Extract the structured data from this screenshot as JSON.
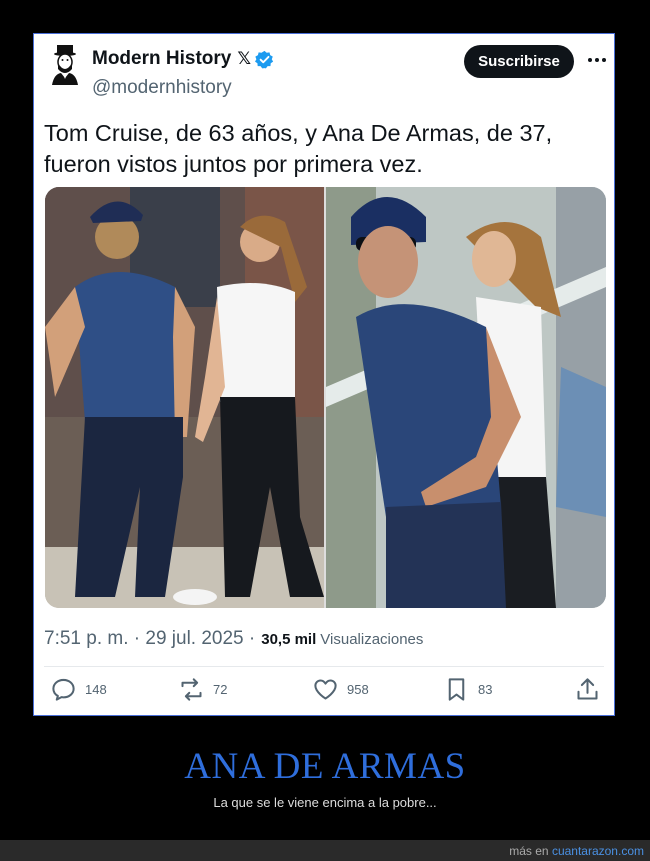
{
  "account": {
    "name": "Modern History",
    "handle": "@modernhistory",
    "subscribe_label": "Suscribirse"
  },
  "tweet": {
    "text_line1": "Tom Cruise, de 63 años, y Ana De Armas, de 37,",
    "text_line2": "fueron vistos juntos por primera vez.",
    "time": "7:51 p. m. · 29 jul. 2025 ·",
    "views_count": "30,5 mil",
    "views_label": "Visualizaciones"
  },
  "stats": {
    "replies": "148",
    "reposts": "72",
    "likes": "958",
    "bookmarks": "83"
  },
  "caption": {
    "title": "ANA DE ARMAS",
    "subtitle": "La que se le viene encima a la pobre..."
  },
  "footer": {
    "prefix": "más en",
    "site": "cuantarazon.com"
  },
  "colors": {
    "accent_blue": "#2f6edc",
    "verified_blue": "#1d9bf0",
    "card_border": "#4a6fd8"
  }
}
